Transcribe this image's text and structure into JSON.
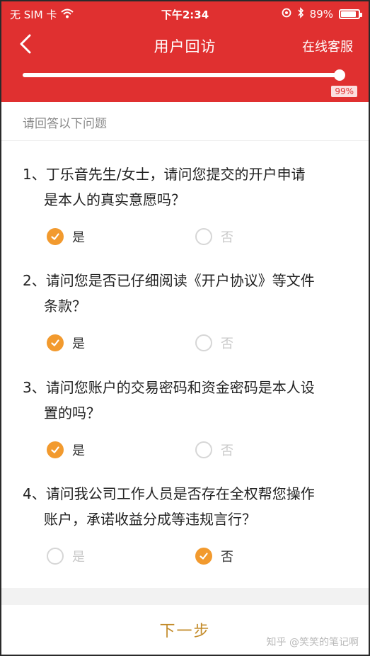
{
  "status": {
    "carrier": "无 SIM 卡",
    "time": "下午2:34",
    "battery": "89%",
    "battery_level": 0.89,
    "wifi_icon": "wifi-icon",
    "location_icon": "location-icon",
    "bluetooth_icon": "bluetooth-icon"
  },
  "nav": {
    "back_icon": "chevron-left-icon",
    "title": "用户回访",
    "service": "在线客服"
  },
  "progress": {
    "value": 0.99,
    "label": "99%"
  },
  "hint": "请回答以下问题",
  "questions": [
    {
      "line1": "1、丁乐音先生/女士，请问您提交的开户申请",
      "line2": "是本人的真实意愿吗？",
      "options": [
        "是",
        "否"
      ],
      "selected": 0
    },
    {
      "line1": "2、请问您是否已仔细阅读《开户协议》等文件",
      "line2": "条款？",
      "options": [
        "是",
        "否"
      ],
      "selected": 0
    },
    {
      "line1": "3、请问您账户的交易密码和资金密码是本人设",
      "line2": "置的吗？",
      "options": [
        "是",
        "否"
      ],
      "selected": 0
    },
    {
      "line1": "4、请问我公司工作人员是否存在全权帮您操作",
      "line2": "账户，承诺收益分成等违规言行？",
      "options": [
        "是",
        "否"
      ],
      "selected": 1
    }
  ],
  "next_button": "下一步",
  "watermark": "知乎 @笑笑的笔记啊",
  "colors": {
    "header": "#e03030",
    "selected": "#f29a2e",
    "next_text": "#c38b2a"
  }
}
